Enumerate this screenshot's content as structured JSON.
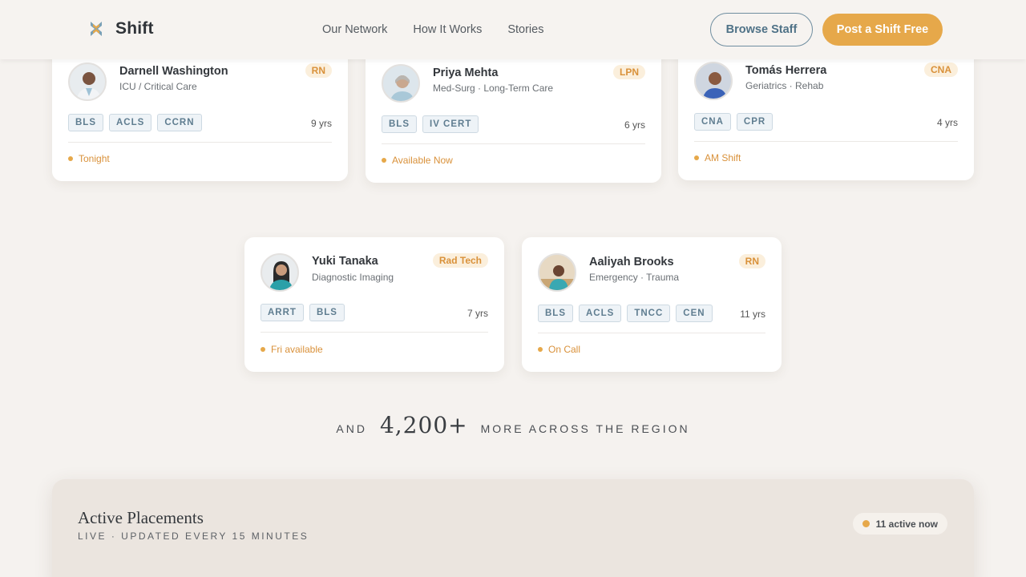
{
  "header": {
    "brand": "Shift",
    "nav": [
      "Our Network",
      "How It Works",
      "Stories"
    ],
    "browse_label": "Browse Staff",
    "post_label": "Post a Shift Free"
  },
  "cards": [
    {
      "name": "Darnell Washington",
      "specialty": "ICU / Critical Care",
      "role": "RN",
      "certs": [
        "BLS",
        "ACLS",
        "CCRN"
      ],
      "years": "9 yrs",
      "availability": "Tonight"
    },
    {
      "name": "Priya Mehta",
      "specialty": "Med-Surg · Long-Term Care",
      "role": "LPN",
      "certs": [
        "BLS",
        "IV CERT"
      ],
      "years": "6 yrs",
      "availability": "Available Now"
    },
    {
      "name": "Tomás Herrera",
      "specialty": "Geriatrics · Rehab",
      "role": "CNA",
      "certs": [
        "CNA",
        "CPR"
      ],
      "years": "4 yrs",
      "availability": "AM Shift"
    },
    {
      "name": "Yuki Tanaka",
      "specialty": "Diagnostic Imaging",
      "role": "Rad Tech",
      "certs": [
        "ARRT",
        "BLS"
      ],
      "years": "7 yrs",
      "availability": "Fri available"
    },
    {
      "name": "Aaliyah Brooks",
      "specialty": "Emergency · Trauma",
      "role": "RN",
      "certs": [
        "BLS",
        "ACLS",
        "TNCC",
        "CEN"
      ],
      "years": "11 yrs",
      "availability": "On Call"
    }
  ],
  "tagline": {
    "prefix": "AND",
    "count": "4,200+",
    "suffix": "MORE ACROSS THE REGION"
  },
  "placements": {
    "title": "Active Placements",
    "subtitle": "LIVE · UPDATED EVERY 15 MINUTES",
    "badge": "11 active now"
  },
  "colors": {
    "accent": "#e6a84a",
    "steel": "#4f7287",
    "background": "#f5f2ef"
  }
}
